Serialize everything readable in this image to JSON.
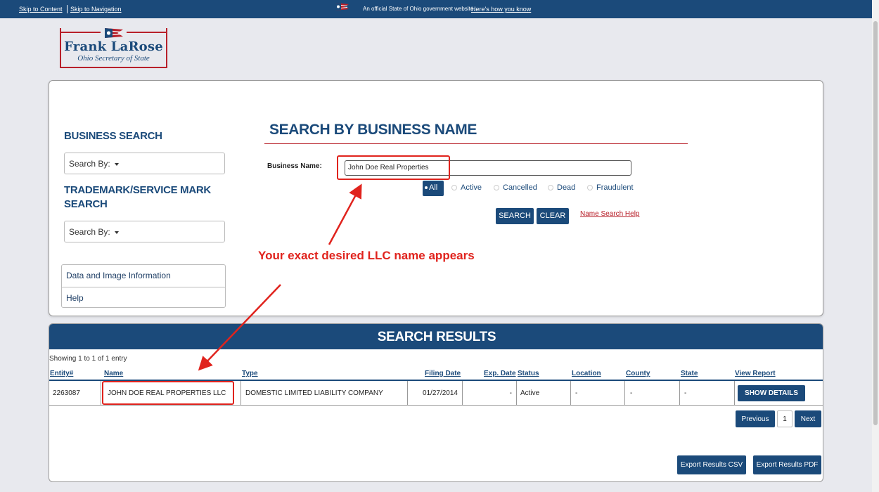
{
  "topbar": {
    "skip_content": "Skip to Content",
    "skip_nav": "Skip to Navigation",
    "official_text": "An official State of Ohio government website.",
    "how_know": "Here's how you know"
  },
  "logo": {
    "name": "Frank LaRose",
    "subtitle": "Ohio Secretary of State"
  },
  "sidebar": {
    "business_search_title": "BUSINESS SEARCH",
    "business_search_dropdown": "Search By:",
    "trademark_title_line1": "TRADEMARK/SERVICE MARK",
    "trademark_title_line2": "SEARCH",
    "trademark_dropdown": "Search By:",
    "links": [
      "Data and Image Information",
      "Help"
    ]
  },
  "search": {
    "title": "SEARCH BY BUSINESS NAME",
    "label": "Business Name:",
    "value": "John Doe Real Properties",
    "filters": {
      "selected": "All",
      "options": [
        "Active",
        "Cancelled",
        "Dead",
        "Fraudulent"
      ]
    },
    "search_button": "SEARCH",
    "clear_button": "CLEAR",
    "help_link": "Name Search Help"
  },
  "annotation": {
    "text": "Your exact desired LLC name appears",
    "color": "#e0231d"
  },
  "results": {
    "title": "SEARCH RESULTS",
    "showing": "Showing 1 to 1 of 1 entry",
    "columns": [
      "Entity#",
      "Name",
      "Type",
      "Filing Date",
      "Exp. Date",
      "Status",
      "Location",
      "County",
      "State",
      "View Report"
    ],
    "rows": [
      {
        "entity": "2263087",
        "name": "JOHN DOE REAL PROPERTIES LLC",
        "type": "DOMESTIC LIMITED LIABILITY COMPANY",
        "filing_date": "01/27/2014",
        "exp_date": "-",
        "status": "Active",
        "location": "-",
        "county": "-",
        "state": "-",
        "action": "SHOW DETAILS"
      }
    ],
    "pagination": {
      "previous": "Previous",
      "page": "1",
      "next": "Next"
    },
    "export_csv": "Export Results CSV",
    "export_pdf": "Export Results PDF"
  },
  "colors": {
    "brand_blue": "#1b4a7a",
    "brand_red": "#b8202a",
    "page_bg": "#e8e9ee"
  }
}
